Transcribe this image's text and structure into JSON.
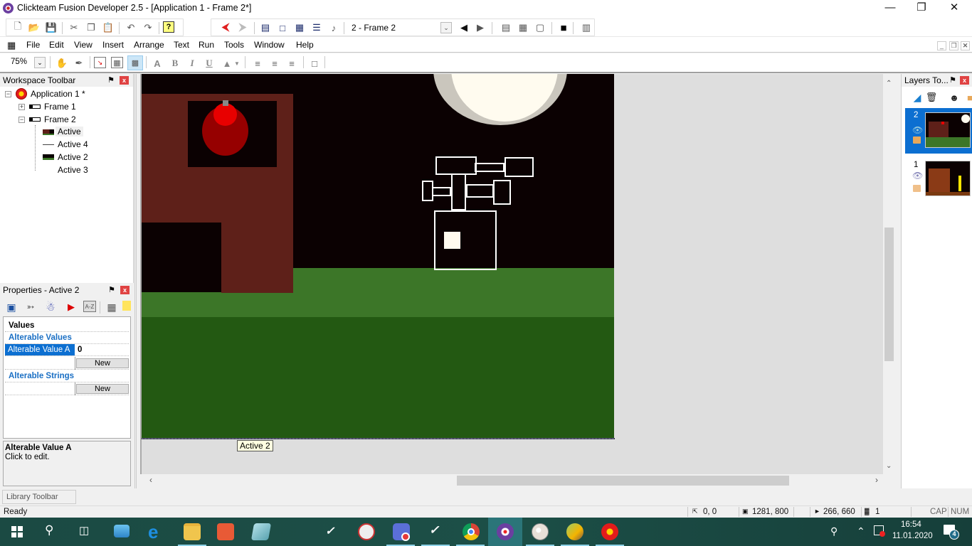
{
  "window": {
    "title": "Clickteam Fusion Developer 2.5 - [Application 1 - Frame 2*]",
    "minimize_icon": "minimize-icon",
    "restore_icon": "restore-icon",
    "close_icon": "close-icon"
  },
  "toolbar1": {
    "buttons": [
      "new-icon",
      "open-icon",
      "save-icon",
      "cut-icon",
      "copy-icon",
      "paste-icon",
      "undo-icon",
      "redo-icon",
      "help-icon",
      "back-icon",
      "forward-icon",
      "storyboard-editor-icon",
      "frame-editor-icon",
      "event-editor-icon",
      "event-list-icon",
      "data-elements-icon"
    ],
    "frame_select": "2 - Frame 2",
    "prev_frame": "◀",
    "next_frame": "▶"
  },
  "menu": {
    "items": [
      "File",
      "Edit",
      "View",
      "Insert",
      "Arrange",
      "Text",
      "Run",
      "Tools",
      "Window",
      "Help"
    ]
  },
  "toolbar2": {
    "zoom": "75%",
    "buttons": [
      "hand-icon",
      "brush-icon",
      "grid-snap-icon",
      "grid-icon",
      "grid-dense-icon",
      "font-icon",
      "bold-icon",
      "italic-icon",
      "underline-icon",
      "fill-color-icon",
      "align-left-icon",
      "align-center-icon",
      "align-right-icon",
      "fit-icon"
    ],
    "bold": "B",
    "italic": "I",
    "underline": "U"
  },
  "workspace": {
    "title": "Workspace Toolbar",
    "tree": {
      "application": "Application 1 *",
      "frames": [
        {
          "label": "Frame 1",
          "expanded": false
        },
        {
          "label": "Frame 2",
          "expanded": true,
          "children": [
            "Active",
            "Active 4",
            "Active 2",
            "Active 3"
          ]
        }
      ]
    }
  },
  "properties": {
    "title": "Properties - Active 2",
    "section": "Values",
    "alterable_values_header": "Alterable Values",
    "alterable_value_a_label": "Alterable Value A",
    "alterable_value_a_value": "0",
    "new_label": "New",
    "alterable_strings_header": "Alterable Strings",
    "help_title": "Alterable Value A",
    "help_text": "Click to edit."
  },
  "library": {
    "tab": "Library Toolbar"
  },
  "editor": {
    "selected_object_tooltip": "Active 2",
    "colors": {
      "sky": "#0b0102",
      "building": "#5e2019",
      "grass_light": "#3c7628",
      "grass_dark": "#235912",
      "moon": "#fffbef",
      "moon_shadow": "#cac6bd",
      "lamp_dark": "#960000",
      "lamp_bright": "#e80000"
    }
  },
  "layers": {
    "title": "Layers To...",
    "items": [
      {
        "number": "2",
        "selected": true
      },
      {
        "number": "1",
        "selected": false
      }
    ]
  },
  "status": {
    "text": "Ready",
    "origin": "0, 0",
    "size": "1281, 800",
    "cursor": "266, 660",
    "layer": "1",
    "cap": "CAP",
    "num": "NUM"
  },
  "taskbar": {
    "time": "16:54",
    "date": "11.01.2020",
    "notifications": "4",
    "apps": [
      "start",
      "search",
      "task-view",
      "computer",
      "edge",
      "file-explorer",
      "presentation",
      "notepad",
      "flash",
      "paint-3d",
      "discord",
      "flash-2",
      "chrome",
      "clickteam-fusion",
      "paint",
      "map-app",
      "clickteam-red"
    ]
  }
}
